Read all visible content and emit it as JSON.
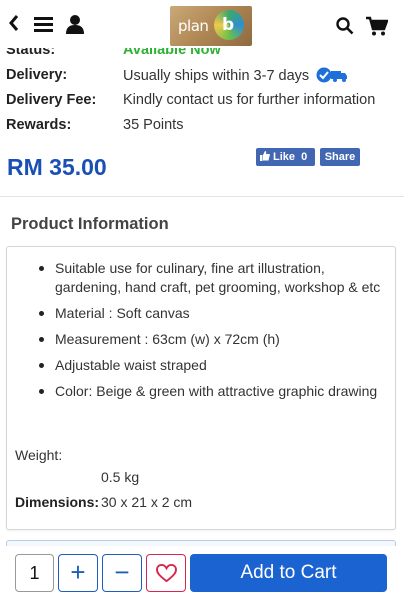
{
  "header": {
    "logo_text": "plan",
    "logo_letter": "b"
  },
  "details": {
    "status": {
      "label": "Status:",
      "value": "Available Now"
    },
    "delivery": {
      "label": "Delivery:",
      "value": "Usually ships within 3-7 days"
    },
    "delivery_fee": {
      "label": "Delivery Fee:",
      "value": "Kindly contact us for further information"
    },
    "rewards": {
      "label": "Rewards:",
      "value": "35 Points"
    }
  },
  "price": "RM 35.00",
  "social": {
    "like_label": "Like",
    "like_count": "0",
    "share_label": "Share"
  },
  "product_info": {
    "title": "Product Information",
    "bullets": [
      "Suitable use for culinary, fine art illustration, gardening, hand craft, pet grooming, workshop & etc",
      "Material : Soft canvas",
      "Measurement : 63cm (w) x 72cm (h)",
      "Adjustable waist straped",
      "Color: Beige & green with attractive graphic drawing"
    ],
    "weight_label": "Weight:",
    "weight_value": "0.5 kg",
    "dimensions_label": "Dimensions:",
    "dimensions_value": "30 x 21 x 2 cm"
  },
  "cart": {
    "quantity": "1",
    "plus": "+",
    "minus": "−",
    "add_to_cart": "Add to Cart"
  },
  "colors": {
    "brand_blue": "#1a63d0",
    "price_blue": "#1a4fb4",
    "status_green": "#2fb036",
    "wishlist_red": "#d7264f"
  }
}
